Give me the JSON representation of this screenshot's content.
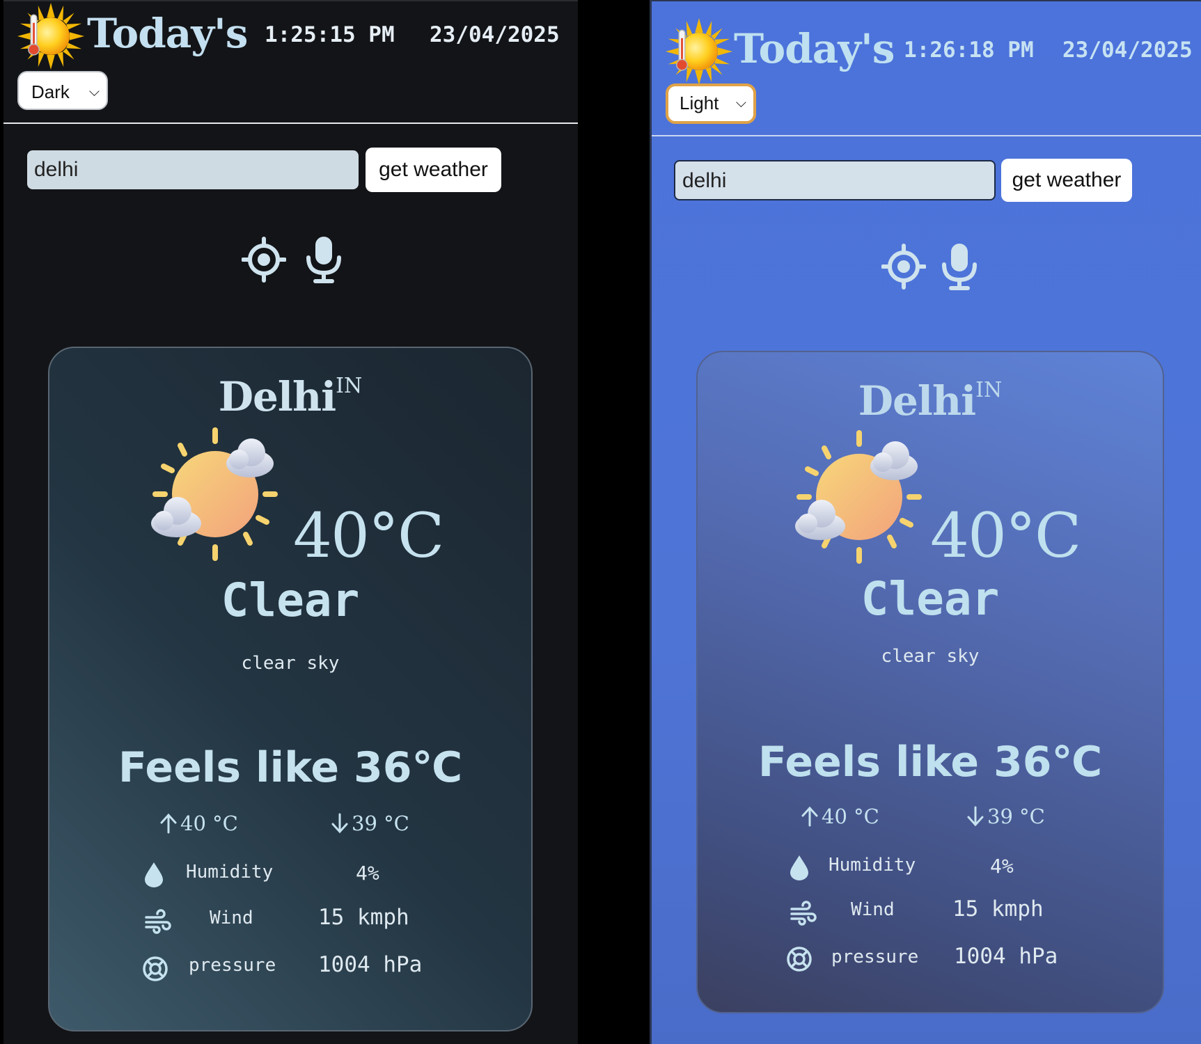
{
  "panels": [
    {
      "theme_label": "Dark",
      "clock": "1:25:15 PM",
      "date": "23/04/2025"
    },
    {
      "theme_label": "Light",
      "clock": "1:26:18 PM",
      "date": "23/04/2025"
    }
  ],
  "app": {
    "title": "Today's"
  },
  "search": {
    "value": "delhi",
    "button_label": "get weather"
  },
  "icons": {
    "locate": "crosshair-icon",
    "voice": "microphone-icon",
    "logo": "sun-thermometer-icon",
    "weather": "sun-clouds-icon"
  },
  "weather": {
    "city": "Delhi",
    "country": "IN",
    "temperature": "40°C",
    "condition": "Clear",
    "description": "clear sky",
    "feels_like": "Feels like 36℃",
    "temp_max": "40 °C",
    "temp_min": "39 °C",
    "humidity_label": "Humidity",
    "humidity_value": "4%",
    "wind_label": "Wind",
    "wind_value": "15 kmph",
    "pressure_label": "pressure",
    "pressure_value": "1004 hPa"
  },
  "colors": {
    "dark_bg": "#131417",
    "light_bg": "#4c73db",
    "accent_text": "#c6e2ef",
    "select_focus": "#e0a247"
  }
}
